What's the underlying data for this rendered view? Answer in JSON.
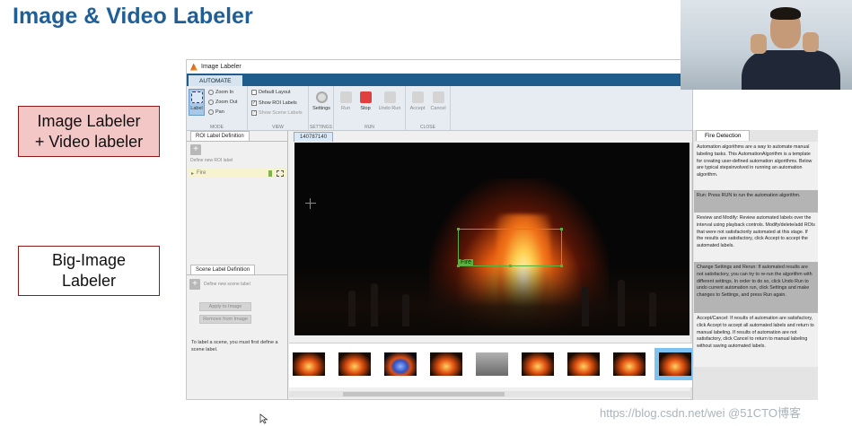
{
  "slide": {
    "title": "Image & Video Labeler",
    "callouts": [
      "Image Labeler\n+ Video labeler",
      "Big-Image\nLabeler"
    ],
    "watermark": "https://blog.csdn.net/wei @51CTO博客"
  },
  "app": {
    "window_title": "Image Labeler",
    "tab": "AUTOMATE",
    "ribbon": {
      "mode": {
        "label_button": "Label",
        "zoom_in": "Zoom In",
        "zoom_out": "Zoom Out",
        "pan": "Pan",
        "group": "MODE"
      },
      "view": {
        "default_layout": "Default Layout",
        "show_roi_labels": "Show ROI Labels",
        "show_scene_labels": "Show Scene Labels",
        "group": "VIEW"
      },
      "settings": {
        "button": "Settings",
        "group": "SETTINGS"
      },
      "run": {
        "run": "Run",
        "stop": "Stop",
        "undo_run": "Undo Run",
        "group": "RUN"
      },
      "close": {
        "accept": "Accept",
        "cancel": "Cancel",
        "group": "CLOSE"
      }
    },
    "left_panel": {
      "roi_tab": "ROI Label Definition",
      "define_roi": "Define new ROI label",
      "roi_items": [
        {
          "name": "Fire",
          "color": "#7ab648"
        }
      ],
      "scene_tab": "Scene Label Definition",
      "define_scene": "Define new scene label",
      "apply_button": "Apply to Image",
      "remove_button": "Remove from Image",
      "hint": "To label a scene, you must first define a scene label."
    },
    "viewer": {
      "image_tab": "140787140",
      "box_label": "Fire",
      "box_color": "#5cb040"
    },
    "filmstrip": {
      "selected_index": 8,
      "thumbs": [
        {
          "icon": "fire-thumbnail-icon"
        },
        {
          "icon": "fire-thumbnail-icon"
        },
        {
          "icon": "blue-fire-thumbnail-icon"
        },
        {
          "icon": "fire-thumbnail-icon"
        },
        {
          "icon": "grey-thumbnail-icon"
        },
        {
          "icon": "fire-thumbnail-icon"
        },
        {
          "icon": "fire-thumbnail-icon"
        },
        {
          "icon": "fire-thumbnail-icon"
        },
        {
          "icon": "fire-thumbnail-icon"
        }
      ]
    },
    "right_panel": {
      "tab": "Fire Detection",
      "sections": [
        "Automation algorithms are a way to automate manual labeling tasks. This AutomationAlgorithm is a template for creating user-defined automation algorithms. Below are typical stepsinvolved in running an automation algorithm.",
        "Run: Press RUN to run the automation algorithm.",
        "Review and Modify: Review automated labels over the interval using playback controls. Modify/delete/add ROIs that were not satisfactorily automated at this stage. If the results are satisfactory, click Accept to accept the automated labels.",
        "Change Settings and Rerun: If automated results are not satisfactory, you can try to re-run the algorithm with different settings. In order to do so, click Undo Run to undo current automation run, click Settings and make changes to Settings, and press Run again.",
        "Accept/Cancel: If results of automation are satisfactory, click Accept to accept all automated labels and return to manual labeling. If results of automation are not satisfactory, click Cancel to return to manual labeling without saving automated labels."
      ]
    }
  },
  "colors": {
    "title": "#1f5e96",
    "callout_border": "#8b1a1a",
    "callout_pink": "#f4c7c7",
    "ribbon_tab": "#1e5c8c",
    "stop_button": "#e04040",
    "selection": "#7ec2f0"
  }
}
